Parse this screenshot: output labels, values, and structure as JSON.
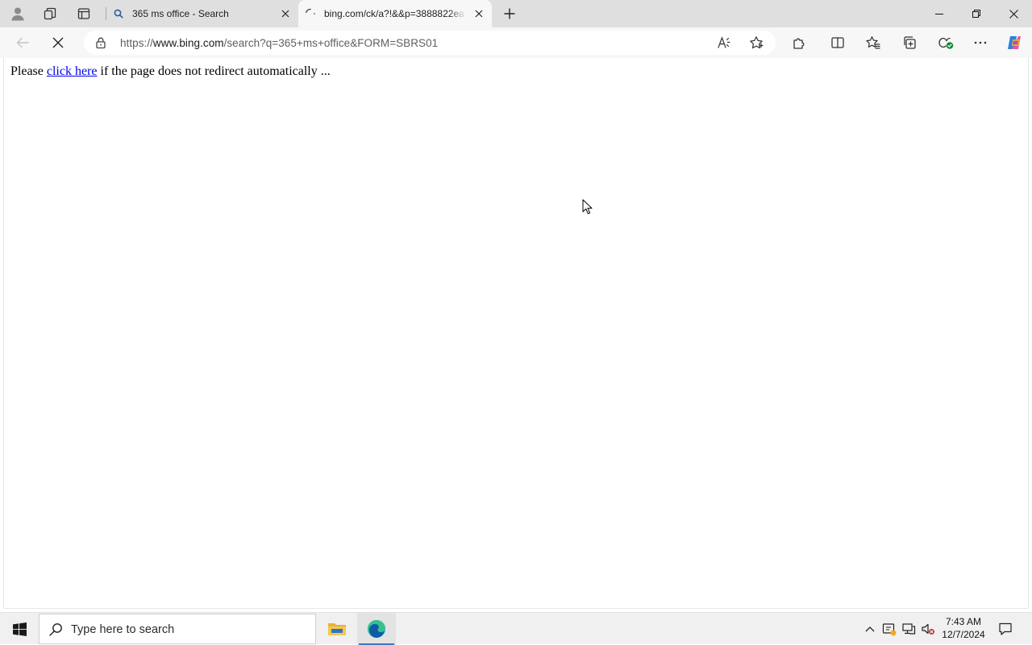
{
  "browser": {
    "tabs": [
      {
        "title": "365 ms office - Search",
        "active": false
      },
      {
        "title": "bing.com/ck/a?!&&p=3888822ea",
        "active": true
      }
    ],
    "address_bar": {
      "url_scheme": "https://",
      "url_host": "www.bing.com",
      "url_path": "/search?q=365+ms+office&FORM=SBRS01"
    },
    "toolbar_icons": [
      "back-icon",
      "stop-loading-icon",
      "lock-icon",
      "read-aloud-icon",
      "favorite-star-icon",
      "extensions-icon",
      "split-screen-icon",
      "favorites-icon",
      "collections-icon",
      "browser-essentials-icon",
      "more-icon",
      "copilot-icon"
    ],
    "accent_color": "#3b78c4"
  },
  "page": {
    "message_prefix": "Please ",
    "link_text": "click here",
    "message_suffix": " if the page does not redirect automatically ...",
    "link_color": "#0000ee"
  },
  "taskbar": {
    "search_placeholder": "Type here to search",
    "clock_time": "7:43 AM",
    "clock_date": "12/7/2024"
  }
}
